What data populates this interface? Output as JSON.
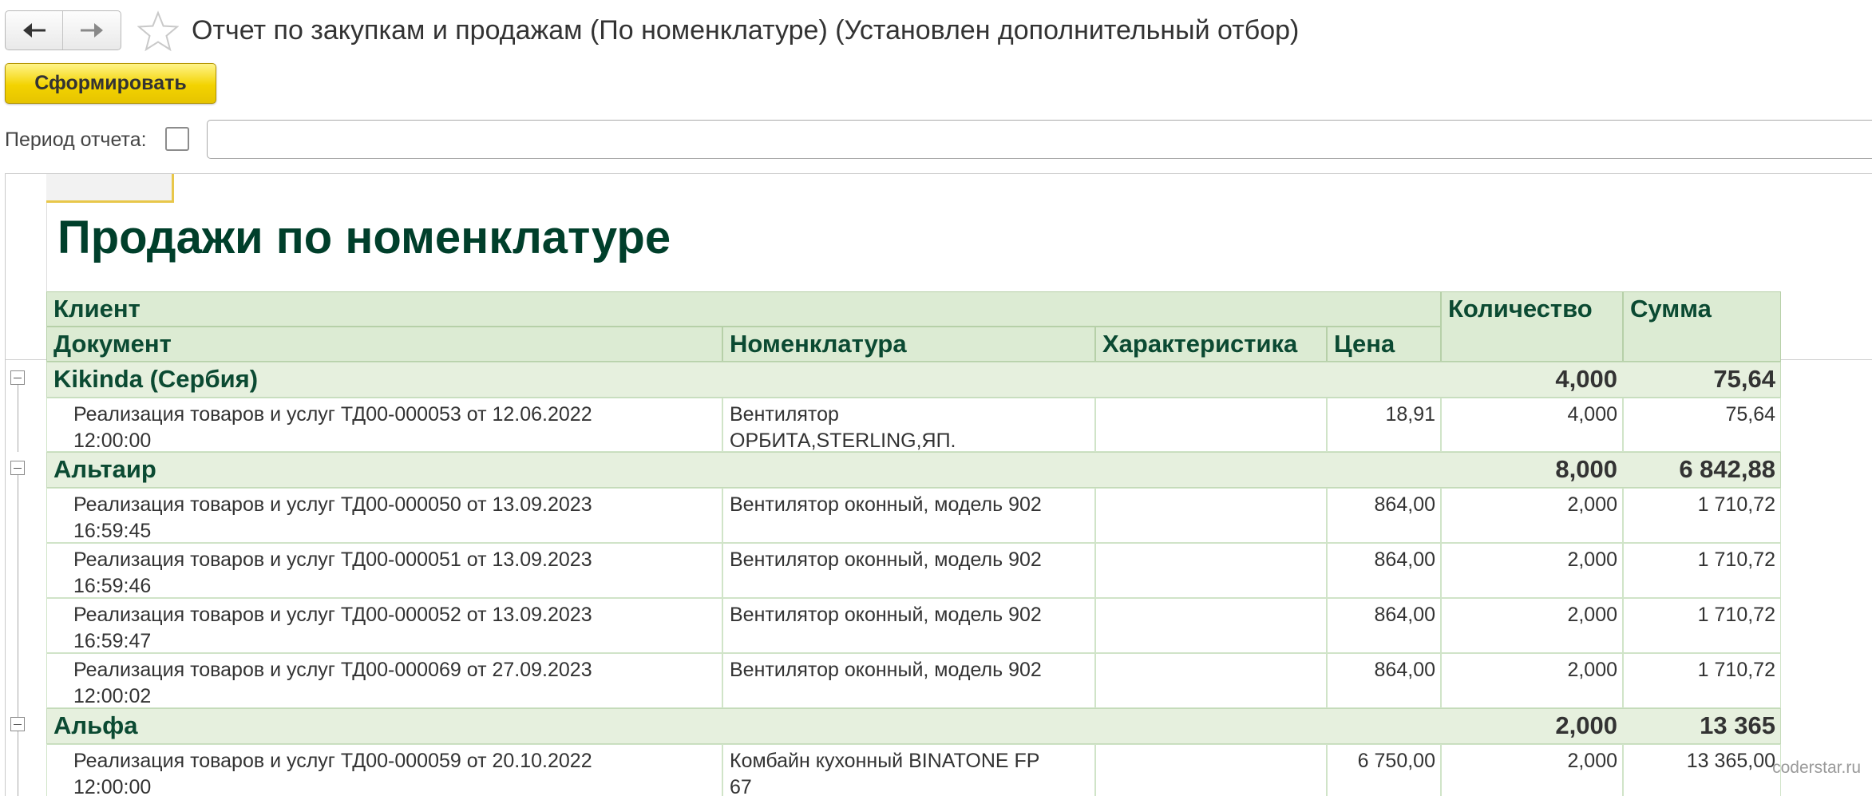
{
  "toolbar": {
    "title": "Отчет по закупкам и продажам (По номенклатуре) (Установлен дополнительный отбор)",
    "generate_label": "Сформировать",
    "period_label": "Период отчета:",
    "period_value": ""
  },
  "report": {
    "title": "Продажи по номенклатуре",
    "headers": {
      "client": "Клиент",
      "document": "Документ",
      "nomenclature": "Номенклатура",
      "characteristic": "Характеристика",
      "price": "Цена",
      "quantity": "Количество",
      "sum": "Сумма"
    },
    "groups": [
      {
        "client": "Kikinda (Сербия)",
        "quantity": "4,000",
        "sum": "75,64",
        "rows": [
          {
            "document": "Реализация товаров и услуг ТД00-000053 от 12.06.2022\n12:00:00",
            "nomenclature": "Вентилятор\nОРБИТА,STERLING,ЯП.",
            "characteristic": "",
            "price": "18,91",
            "quantity": "4,000",
            "sum": "75,64"
          }
        ]
      },
      {
        "client": "Альтаир",
        "quantity": "8,000",
        "sum": "6 842,88",
        "rows": [
          {
            "document": "Реализация товаров и услуг ТД00-000050 от 13.09.2023\n16:59:45",
            "nomenclature": "Вентилятор оконный, модель 902",
            "characteristic": "",
            "price": "864,00",
            "quantity": "2,000",
            "sum": "1 710,72"
          },
          {
            "document": "Реализация товаров и услуг ТД00-000051 от 13.09.2023\n16:59:46",
            "nomenclature": "Вентилятор оконный, модель 902",
            "characteristic": "",
            "price": "864,00",
            "quantity": "2,000",
            "sum": "1 710,72"
          },
          {
            "document": "Реализация товаров и услуг ТД00-000052 от 13.09.2023\n16:59:47",
            "nomenclature": "Вентилятор оконный, модель 902",
            "characteristic": "",
            "price": "864,00",
            "quantity": "2,000",
            "sum": "1 710,72"
          },
          {
            "document": "Реализация товаров и услуг ТД00-000069 от 27.09.2023\n12:00:02",
            "nomenclature": "Вентилятор оконный, модель 902",
            "characteristic": "",
            "price": "864,00",
            "quantity": "2,000",
            "sum": "1 710,72"
          }
        ]
      },
      {
        "client": "Альфа",
        "quantity": "2,000",
        "sum": "13 365",
        "rows": [
          {
            "document": "Реализация товаров и услуг ТД00-000059 от 20.10.2022\n12:00:00",
            "nomenclature": "Комбайн кухонный BINATONE FP\n67",
            "characteristic": "",
            "price": "6 750,00",
            "quantity": "2,000",
            "sum": "13 365,00"
          }
        ]
      }
    ]
  },
  "watermark": "coderstar.ru",
  "colors": {
    "accent_yellow": "#f3d300",
    "header_green": "#dcebd3",
    "title_green": "#003f2b"
  },
  "icons": [
    "arrow-left-icon",
    "arrow-right-icon",
    "star-icon",
    "collapse-icon"
  ]
}
